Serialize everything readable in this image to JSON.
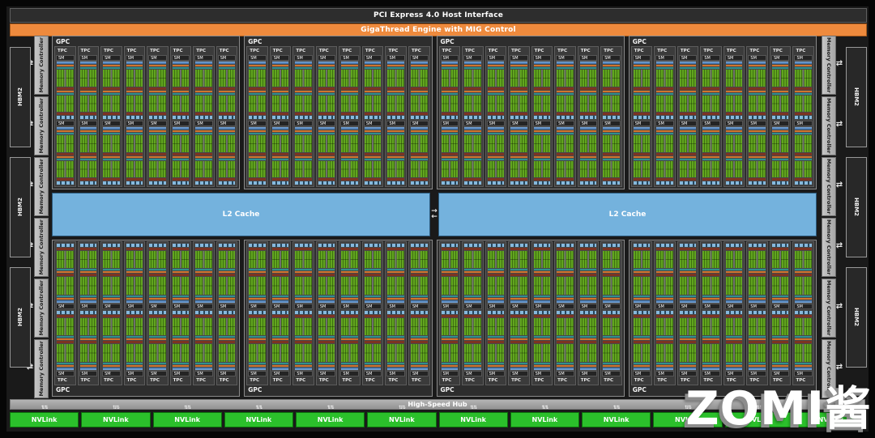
{
  "header": {
    "pci": "PCI Express 4.0 Host Interface",
    "gigathread": "GigaThread Engine with MIG Control"
  },
  "memory": {
    "hbm_label": "HBM2",
    "controller_label": "Memory Controller",
    "hbm_per_side": 3,
    "controllers_per_side": 6
  },
  "gpc": {
    "label": "GPC",
    "tpc_label": "TPC",
    "sm_label": "SM",
    "top_row_count": 4,
    "bottom_row_count": 4,
    "tpcs_per_gpc": 8,
    "sms_per_tpc": 2
  },
  "l2": {
    "label": "L2 Cache",
    "count": 2
  },
  "hub": {
    "label": "High-Speed Hub"
  },
  "nvlink": {
    "label": "NVLink",
    "count": 12
  },
  "watermark": "ZOMI酱",
  "icons": {
    "hbm_mc_arrow": "⇄",
    "l2_arrow_right": "→",
    "l2_arrow_left": "←",
    "nvlink_arrow": "⇅⇅"
  },
  "colors": {
    "orange": "#EE8A3D",
    "l2_blue": "#74B2DD",
    "nvlink_green": "#2BC02B",
    "core_green": "#61A51F",
    "sm_blue": "#3D6EA8",
    "teal": "#2F8F8F",
    "tensor_dark_red": "#7C3322",
    "mc_gray": "#B5B5B5",
    "hub_gray": "#9E9E9E"
  }
}
